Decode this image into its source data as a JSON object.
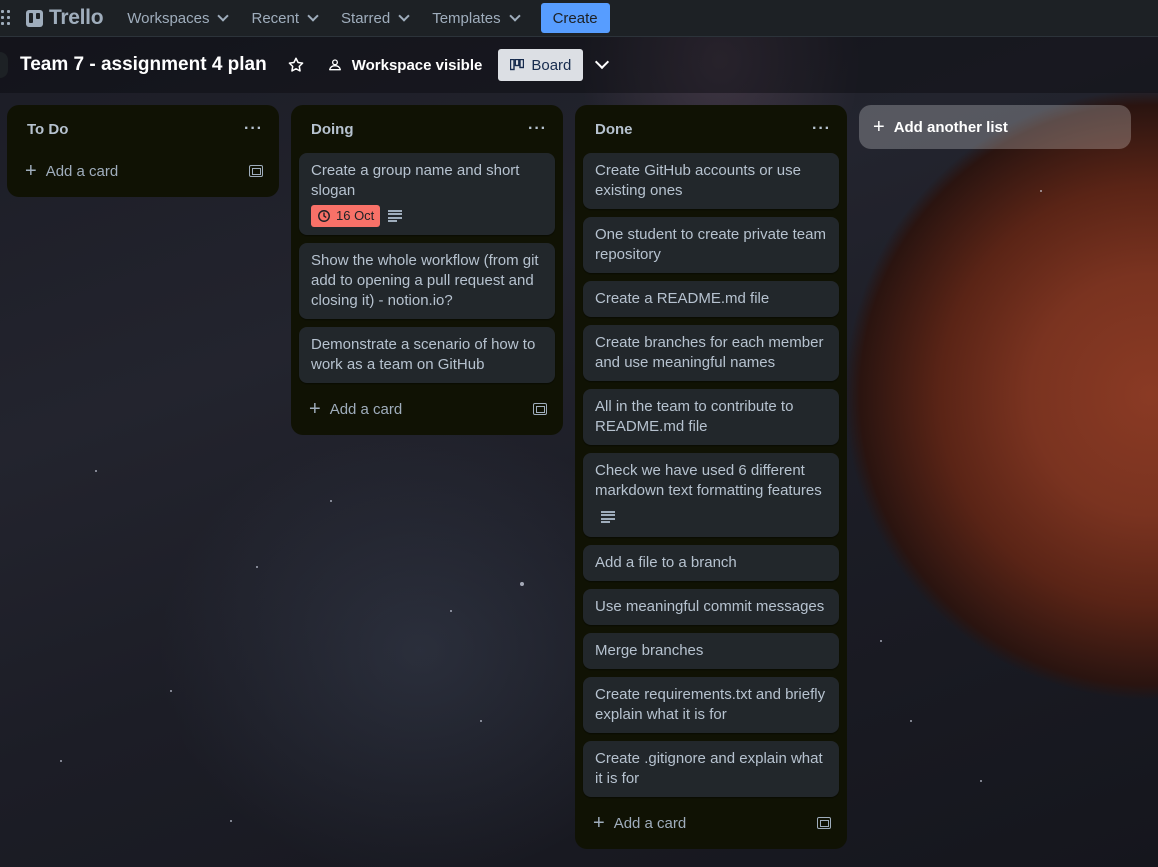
{
  "nav": {
    "brand": "Trello",
    "items": [
      "Workspaces",
      "Recent",
      "Starred",
      "Templates"
    ],
    "create_label": "Create"
  },
  "board": {
    "title": "Team 7 - assignment 4 plan",
    "visibility": "Workspace visible",
    "view_label": "Board"
  },
  "lists": [
    {
      "title": "To Do",
      "cards": [],
      "add_card_label": "Add a card"
    },
    {
      "title": "Doing",
      "cards": [
        {
          "text": "Create a group name and short slogan",
          "due": "16 Oct",
          "has_description": true
        },
        {
          "text": "Show the whole workflow (from git add to opening a pull request and closing it) - notion.io?"
        },
        {
          "text": "Demonstrate a scenario of how to work as a team on GitHub"
        }
      ],
      "add_card_label": "Add a card"
    },
    {
      "title": "Done",
      "cards": [
        {
          "text": "Create GitHub accounts or use existing ones"
        },
        {
          "text": "One student to create private team repository"
        },
        {
          "text": "Create a README.md file"
        },
        {
          "text": "Create branches for each member and use meaningful names"
        },
        {
          "text": "All in the team to contribute to README.md file"
        },
        {
          "text": "Check we have used 6 different markdown text formatting features",
          "has_description": true
        },
        {
          "text": "Add a file to a branch"
        },
        {
          "text": "Use meaningful commit messages"
        },
        {
          "text": "Merge branches"
        },
        {
          "text": "Create requirements.txt and briefly explain what it is for"
        },
        {
          "text": "Create .gitignore and explain what it is for"
        }
      ],
      "add_card_label": "Add a card"
    }
  ],
  "add_list_label": "Add another list",
  "colors": {
    "nav_bg": "#1d2125",
    "list_bg": "#101204",
    "card_bg": "#22272b",
    "create_button": "#579dff",
    "due_badge": "#f87168"
  }
}
